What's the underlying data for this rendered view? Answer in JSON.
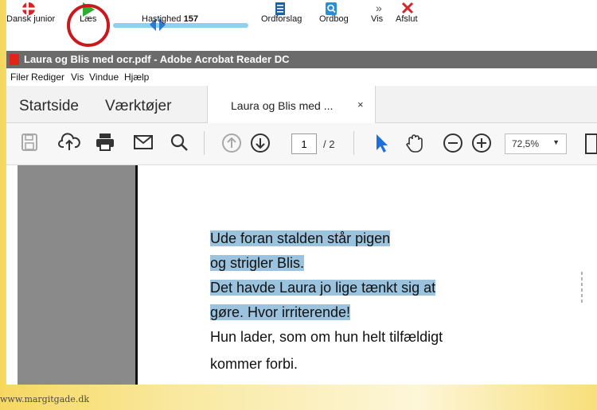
{
  "appwriter": {
    "language_label": "Dansk junior",
    "read_label": "Læs",
    "speed_label": "Hastighed",
    "speed_value": "157",
    "suggestions_label": "Ordforslag",
    "dictionary_label": "Ordbog",
    "show_label": "Vis",
    "exit_label": "Afslut",
    "accent_green": "#2eae2e",
    "accent_red": "#d3262b",
    "accent_blue": "#2a7bd6"
  },
  "acrobat": {
    "window_title": "Laura og Blis med ocr.pdf - Adobe Acrobat Reader DC",
    "menu": [
      "Filer",
      "Rediger",
      "Vis",
      "Vindue",
      "Hjælp"
    ],
    "tabs": {
      "home": "Startside",
      "tools": "Værktøjer",
      "document": "Laura og Blis med ...",
      "close": "×"
    },
    "page_current": "1",
    "page_total": "/ 2",
    "zoom": "72,5%"
  },
  "document": {
    "lines": [
      {
        "text": "Ude foran stalden står pigen",
        "highlighted": true
      },
      {
        "text": "og strigler Blis.",
        "highlighted": true
      },
      {
        "text": "Det havde Laura jo lige tænkt sig at",
        "highlighted": true
      },
      {
        "text": "gøre. Hvor irriterende!",
        "highlighted": true
      },
      {
        "text": "Hun lader, som om hun helt tilfældigt",
        "highlighted": false
      },
      {
        "text": "kommer forbi.",
        "highlighted": false
      }
    ]
  },
  "footer": {
    "watermark": "www.margitgade.dk"
  }
}
